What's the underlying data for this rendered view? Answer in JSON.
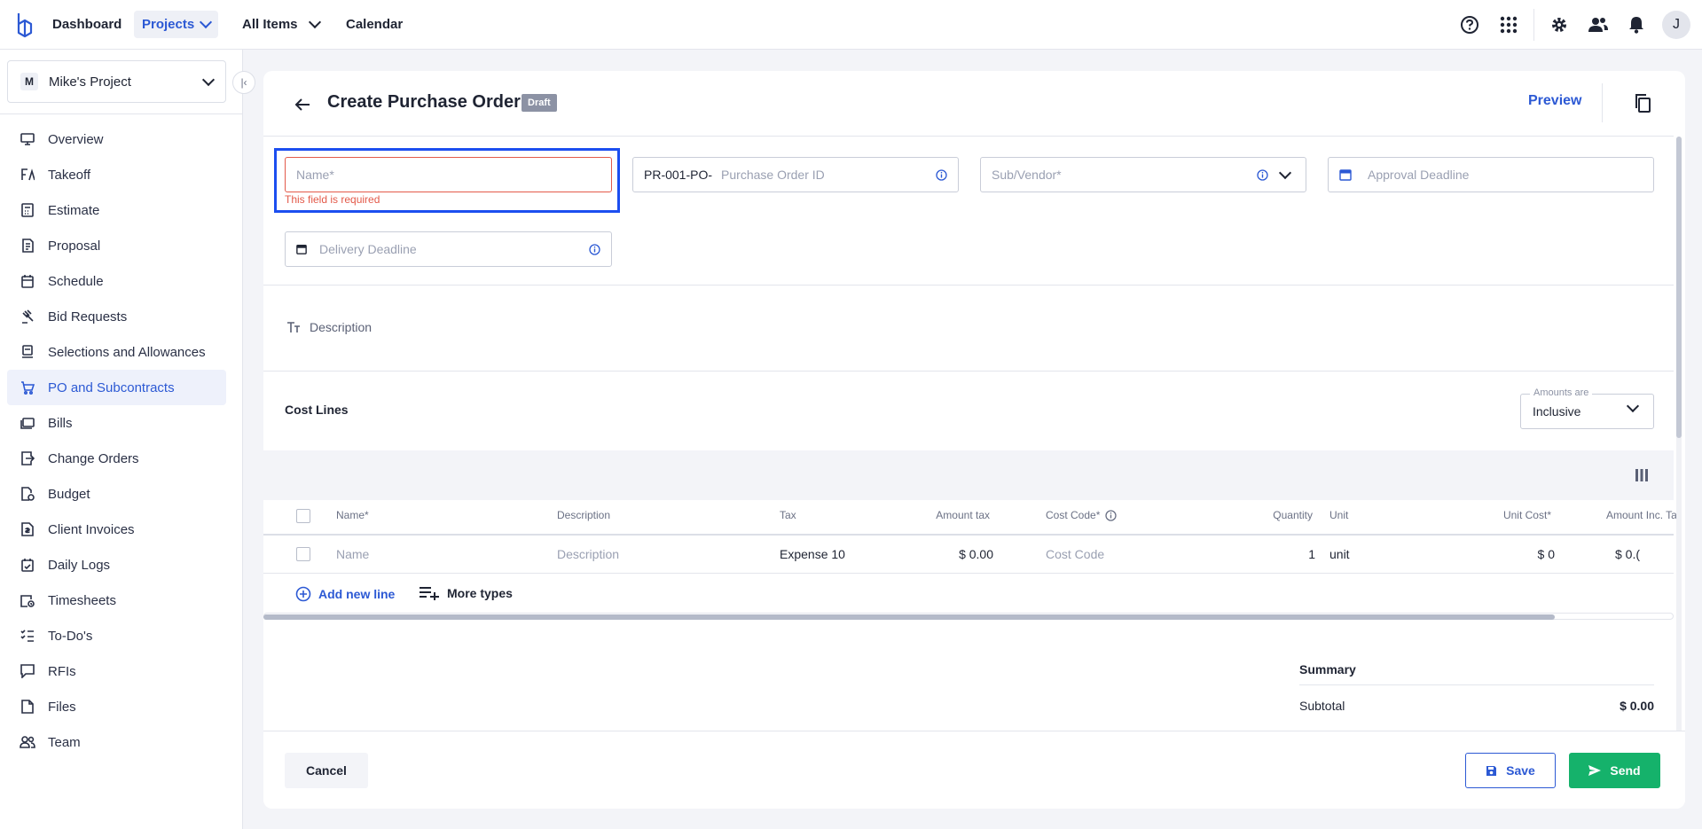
{
  "colors": {
    "accent": "#2c59d4",
    "error": "#e35a4a",
    "send": "#15b26b",
    "focus": "#1c4ef0"
  },
  "topnav": {
    "items": [
      {
        "label": "Dashboard"
      },
      {
        "label": "Projects"
      },
      {
        "label": "All Items"
      },
      {
        "label": "Calendar"
      }
    ],
    "icons": [
      "help-icon",
      "apps-grid-icon",
      "gear-icon",
      "people-icon",
      "bell-icon"
    ],
    "avatar_initial": "J"
  },
  "sidebar": {
    "project": {
      "badge": "M",
      "name": "Mike's Project"
    },
    "items": [
      {
        "label": "Overview",
        "icon": "monitor-icon"
      },
      {
        "label": "Takeoff",
        "icon": "takeoff-icon"
      },
      {
        "label": "Estimate",
        "icon": "calculator-icon"
      },
      {
        "label": "Proposal",
        "icon": "proposal-icon"
      },
      {
        "label": "Schedule",
        "icon": "calendar-icon"
      },
      {
        "label": "Bid Requests",
        "icon": "gavel-icon"
      },
      {
        "label": "Selections and Allowances",
        "icon": "selections-icon"
      },
      {
        "label": "PO and Subcontracts",
        "icon": "cart-icon"
      },
      {
        "label": "Bills",
        "icon": "bills-icon"
      },
      {
        "label": "Change Orders",
        "icon": "change-orders-icon"
      },
      {
        "label": "Budget",
        "icon": "budget-icon"
      },
      {
        "label": "Client Invoices",
        "icon": "invoice-icon"
      },
      {
        "label": "Daily Logs",
        "icon": "daily-log-icon"
      },
      {
        "label": "Timesheets",
        "icon": "timesheet-icon"
      },
      {
        "label": "To-Do's",
        "icon": "todo-icon"
      },
      {
        "label": "RFIs",
        "icon": "rfi-icon"
      },
      {
        "label": "Files",
        "icon": "file-icon"
      },
      {
        "label": "Team",
        "icon": "team-icon"
      }
    ],
    "active_item": "PO and Subcontracts"
  },
  "header": {
    "title": "Create Purchase Order",
    "status_badge": "Draft",
    "preview_label": "Preview"
  },
  "form": {
    "name": {
      "placeholder": "Name*",
      "value": "",
      "error": "This field is required"
    },
    "po_id": {
      "prefix": "PR-001-PO-",
      "placeholder": "Purchase Order ID"
    },
    "vendor": {
      "placeholder": "Sub/Vendor*"
    },
    "approval_deadline": {
      "placeholder": "Approval Deadline"
    },
    "delivery_deadline": {
      "placeholder": "Delivery Deadline"
    },
    "description": {
      "placeholder": "Description"
    }
  },
  "cost_lines": {
    "title": "Cost Lines",
    "amounts_are": {
      "legend": "Amounts are",
      "value": "Inclusive"
    },
    "columns": [
      "Name*",
      "Description",
      "Tax",
      "Amount tax",
      "Cost Code*",
      "Quantity",
      "Unit",
      "Unit Cost*",
      "Amount Inc. Ta"
    ],
    "row": {
      "name": "Name",
      "description": "Description",
      "tax": "Expense 10",
      "amount_tax": "$ 0.00",
      "cost_code": "Cost Code",
      "quantity": "1",
      "unit": "unit",
      "unit_cost": "$ 0",
      "amount_inc_tax": "$ 0.("
    },
    "add_line_label": "Add new line",
    "more_types_label": "More types"
  },
  "summary": {
    "title": "Summary",
    "subtotal_label": "Subtotal",
    "subtotal_value": "$ 0.00"
  },
  "footer": {
    "cancel_label": "Cancel",
    "save_label": "Save",
    "send_label": "Send"
  }
}
